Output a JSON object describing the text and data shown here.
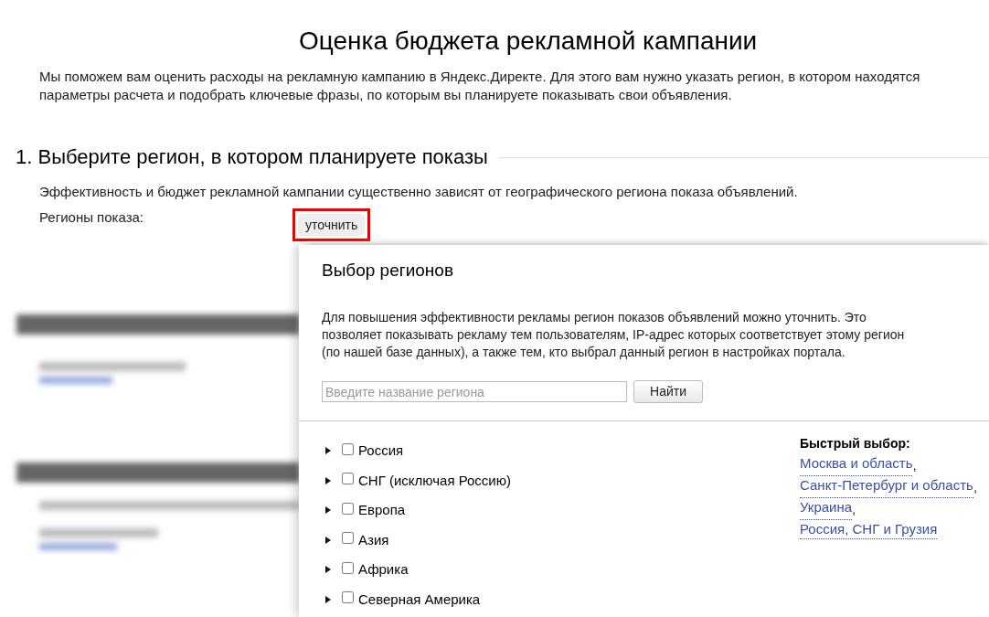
{
  "page_title": "Оценка бюджета рекламной кампании",
  "intro_lines": [
    "Мы поможем вам оценить расходы на рекламную кампанию в Яндекс.Директе. Для этого вам нужно указать регион, в котором находятся",
    "параметры расчета и подобрать ключевые фразы, по которым вы планируете показывать свои объявления."
  ],
  "section": {
    "heading": "1. Выберите регион, в котором планируете показы",
    "description": "Эффективность и бюджет рекламной кампании существенно зависят от географического региона показа объявлений.",
    "regions_label": "Регионы показа:",
    "refine_button": "уточнить"
  },
  "dialog": {
    "title": "Выбор регионов",
    "text_lines": [
      "Для повышения эффективности рекламы регион показов объявлений можно уточнить. Это",
      "позволяет показывать рекламу тем пользователям, IP-адрес которых соответствует этому регион",
      "(по нашей базе данных), а также тем, кто выбрал данный регион в настройках портала."
    ],
    "search": {
      "placeholder": "Введите название региона"
    },
    "find_button": "Найти",
    "regions": [
      {
        "label": "Россия",
        "checked": false,
        "expanded": false
      },
      {
        "label": "СНГ (исключая Россию)",
        "checked": false,
        "expanded": false
      },
      {
        "label": "Европа",
        "checked": false,
        "expanded": false
      },
      {
        "label": "Азия",
        "checked": false,
        "expanded": false
      },
      {
        "label": "Африка",
        "checked": false,
        "expanded": false
      },
      {
        "label": "Северная Америка",
        "checked": false,
        "expanded": false
      }
    ],
    "quick_select": {
      "heading": "Быстрый выбор:",
      "links": [
        {
          "label": "Москва и область",
          "separator": ","
        },
        {
          "label": "Санкт-Петербург и область",
          "separator": ","
        },
        {
          "label": "Украина",
          "separator": ","
        },
        {
          "label": "Россия, СНГ и Грузия"
        }
      ]
    }
  }
}
